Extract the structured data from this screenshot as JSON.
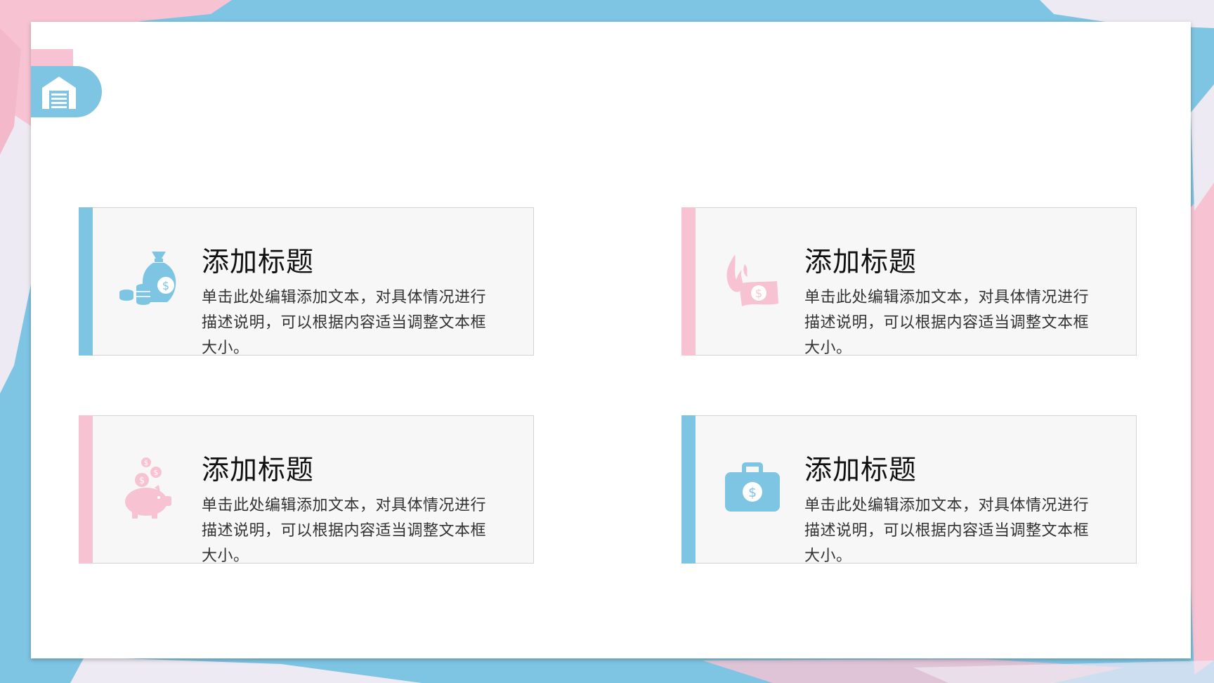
{
  "colors": {
    "accent_blue": "#7ec4e3",
    "accent_pink": "#f7c3d2",
    "card_bg": "#f7f7f7"
  },
  "header": {
    "logo_icon": "warehouse-icon"
  },
  "cards": [
    {
      "title": "添加标题",
      "desc": "单击此处编辑添加文本，对具体情况进行描述说明，可以根据内容适当调整文本框大小。",
      "icon": "money-bag-coins-icon",
      "bar_color": "blue"
    },
    {
      "title": "添加标题",
      "desc": "单击此处编辑添加文本，对具体情况进行描述说明，可以根据内容适当调整文本框大小。",
      "icon": "burning-money-icon",
      "bar_color": "pink"
    },
    {
      "title": "添加标题",
      "desc": "单击此处编辑添加文本，对具体情况进行描述说明，可以根据内容适当调整文本框大小。",
      "icon": "piggy-bank-icon",
      "bar_color": "pink"
    },
    {
      "title": "添加标题",
      "desc": "单击此处编辑添加文本，对具体情况进行描述说明，可以根据内容适当调整文本框大小。",
      "icon": "money-briefcase-icon",
      "bar_color": "blue"
    }
  ]
}
